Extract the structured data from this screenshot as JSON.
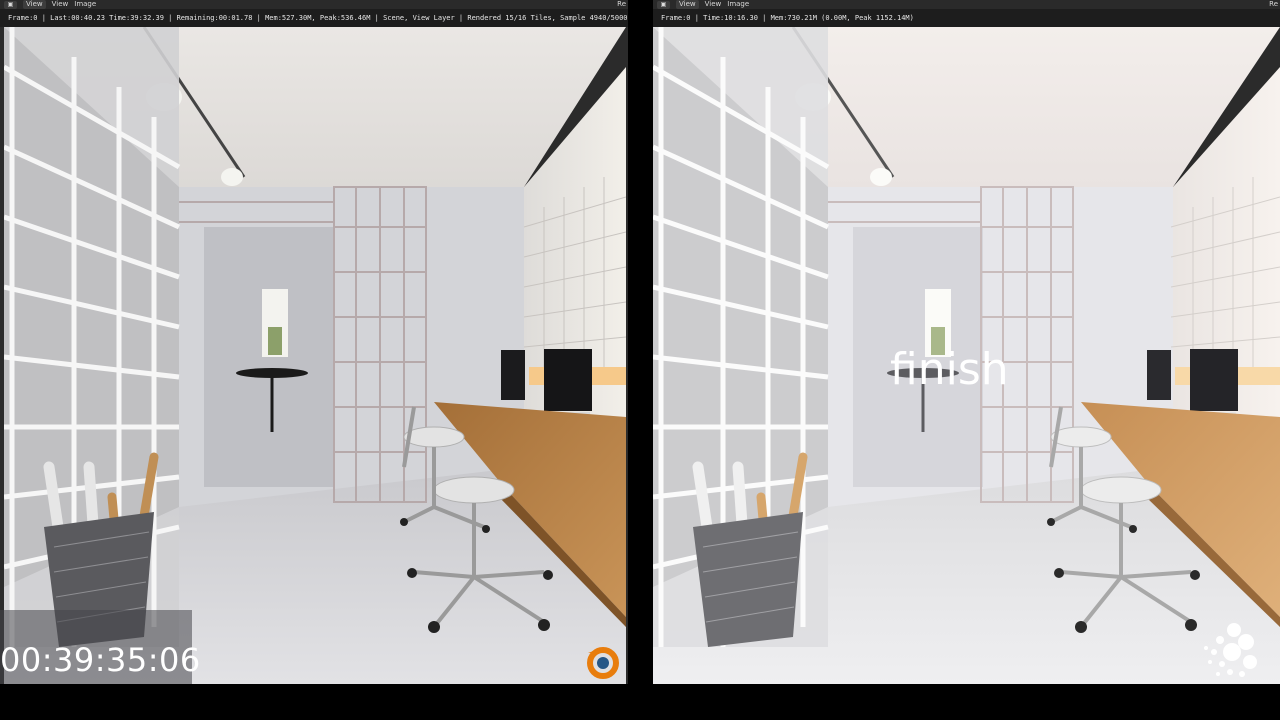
{
  "left_panel": {
    "menu": {
      "view_label": "View",
      "view2_label": "View",
      "image_label": "Image",
      "edge_label": "Re"
    },
    "info_text": "Frame:0 | Last:00:40.23 Time:39:32.39 | Remaining:00:01.78 | Mem:527.30M, Peak:536.46M | Scene, View Layer | Rendered 15/16 Tiles, Sample 4940/5000",
    "timecode": "00:39:35:06",
    "logo_icon": "blender-logo-icon"
  },
  "right_panel": {
    "menu": {
      "view_label": "View",
      "view2_label": "View",
      "image_label": "Image",
      "edge_label": "Re"
    },
    "info_text": "Frame:0 | Time:10:16.30 | Mem:730.21M (0.00M, Peak 1152.14M)",
    "overlay_label": "finish",
    "logo_icon": "dots-logo-icon"
  },
  "colors": {
    "ui_dark": "#2a2a2a",
    "info_bar": "#1d1d1d",
    "floor": "#d9d9dc",
    "desk_wood": "#b07a3e",
    "blender_orange": "#e87d0d",
    "blender_blue": "#265787"
  }
}
